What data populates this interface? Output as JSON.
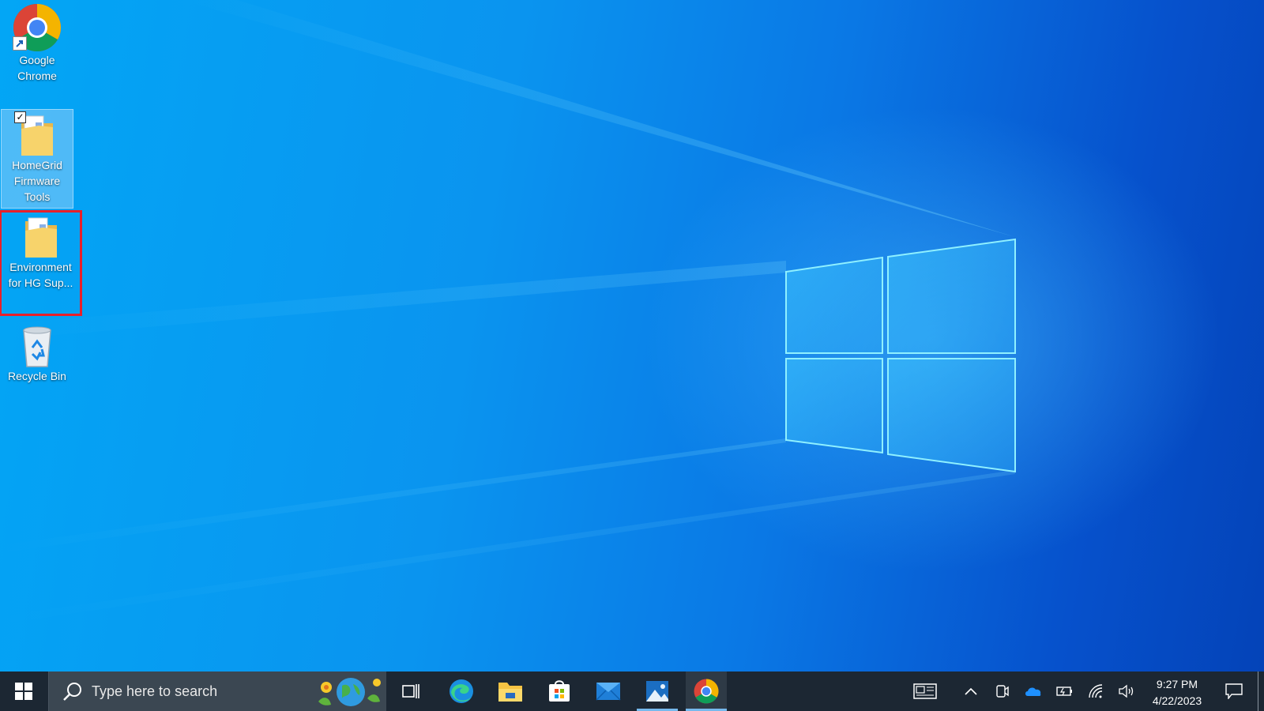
{
  "desktop": {
    "icons": [
      {
        "label": "Google Chrome",
        "icon": "chrome-icon",
        "shortcut": true
      },
      {
        "label": "HomeGrid Firmware Tools",
        "icon": "folder-icon",
        "selected": true,
        "checked": true
      },
      {
        "label": "Environment for HG Sup...",
        "icon": "folder-icon",
        "highlighted": true,
        "highlight_color": "#e8202a"
      },
      {
        "label": "Recycle Bin",
        "icon": "recycle-bin-icon"
      }
    ]
  },
  "taskbar": {
    "search_placeholder": "Type here to search",
    "pinned_apps": [
      {
        "name": "task-view-icon"
      },
      {
        "name": "edge-icon"
      },
      {
        "name": "file-explorer-icon"
      },
      {
        "name": "microsoft-store-icon"
      },
      {
        "name": "mail-icon"
      },
      {
        "name": "photos-icon",
        "active": true
      },
      {
        "name": "chrome-icon",
        "active": true
      }
    ],
    "tray": [
      "news-icon",
      "chevron-up-icon",
      "meet-now-icon",
      "onedrive-icon",
      "battery-icon",
      "wifi-icon",
      "volume-icon"
    ],
    "clock": {
      "time": "9:27 PM",
      "date": "4/22/2023"
    },
    "colors": {
      "taskbar": "#1c2733",
      "search": "#3b4752",
      "accent": "#76b9ed"
    }
  }
}
